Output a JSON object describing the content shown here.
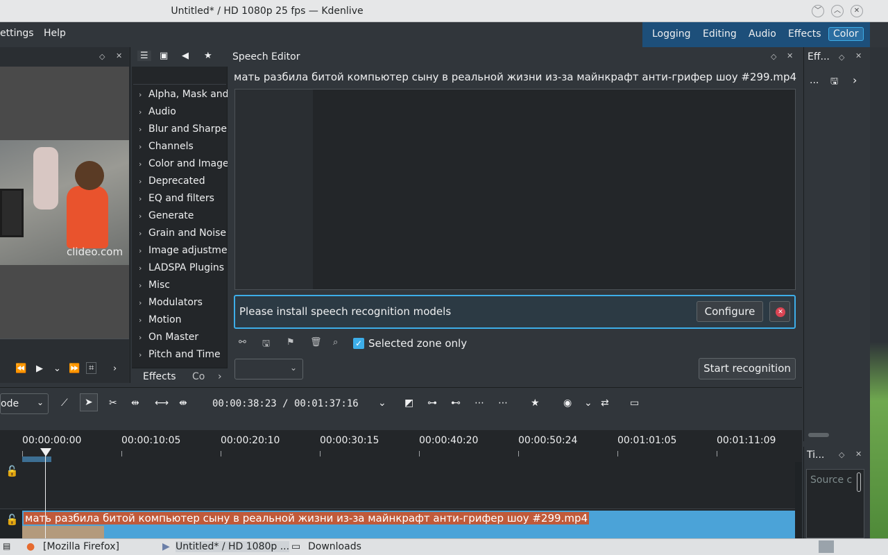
{
  "window": {
    "title": "Untitled* / HD 1080p 25 fps — Kdenlive",
    "buttons": [
      "minimize",
      "maximize",
      "close"
    ]
  },
  "menu": {
    "items": [
      "ettings",
      "Help"
    ]
  },
  "layouts": {
    "items": [
      "Logging",
      "Editing",
      "Audio",
      "Effects",
      "Color"
    ],
    "active": "Color"
  },
  "monitor": {
    "watermark": "clideo.com"
  },
  "effects_panel": {
    "items": [
      "Alpha, Mask and",
      "Audio",
      "Blur and Sharpen",
      "Channels",
      "Color and Image",
      "Deprecated",
      "EQ and filters",
      "Generate",
      "Grain and Noise",
      "Image adjustmen",
      "LADSPA Plugins",
      "Misc",
      "Modulators",
      "Motion",
      "On Master",
      "Pitch and Time"
    ],
    "tabs": [
      "Effects",
      "Co"
    ]
  },
  "speech_editor": {
    "title": "Speech Editor",
    "clip_name": "мать разбила битой компьютер сыну в реальной жизни из-за майнкрафт анти-грифер шоу #299.mp4",
    "message": "Please install speech recognition models",
    "configure_label": "Configure",
    "selected_zone_label": "Selected zone only",
    "selected_zone_checked": true,
    "start_label": "Start recognition"
  },
  "right_panel": {
    "title": "Eff...",
    "dots": "...",
    "time_panel_title": "Ti...",
    "source_placeholder": "Source c"
  },
  "timeline_toolbar": {
    "mode": "ode",
    "timecode": "00:00:38:23 / 00:01:37:16"
  },
  "timeline": {
    "ruler": [
      "00:00:00:00",
      "00:00:10:05",
      "00:00:20:10",
      "00:00:30:15",
      "00:00:40:20",
      "00:00:50:24",
      "00:01:01:05",
      "00:01:11:09"
    ],
    "clip_title": "мать разбила битой компьютер сыну в реальной жизни из-за майнкрафт анти-грифер шоу #299.mp4"
  },
  "taskbar": {
    "items": [
      "[Mozilla Firefox]",
      "Untitled* / HD 1080p ...",
      "Downloads"
    ]
  },
  "colors": {
    "accent": "#3daee9",
    "background": "#31363b",
    "clip": "#4ba3d8",
    "error": "#da4453"
  }
}
